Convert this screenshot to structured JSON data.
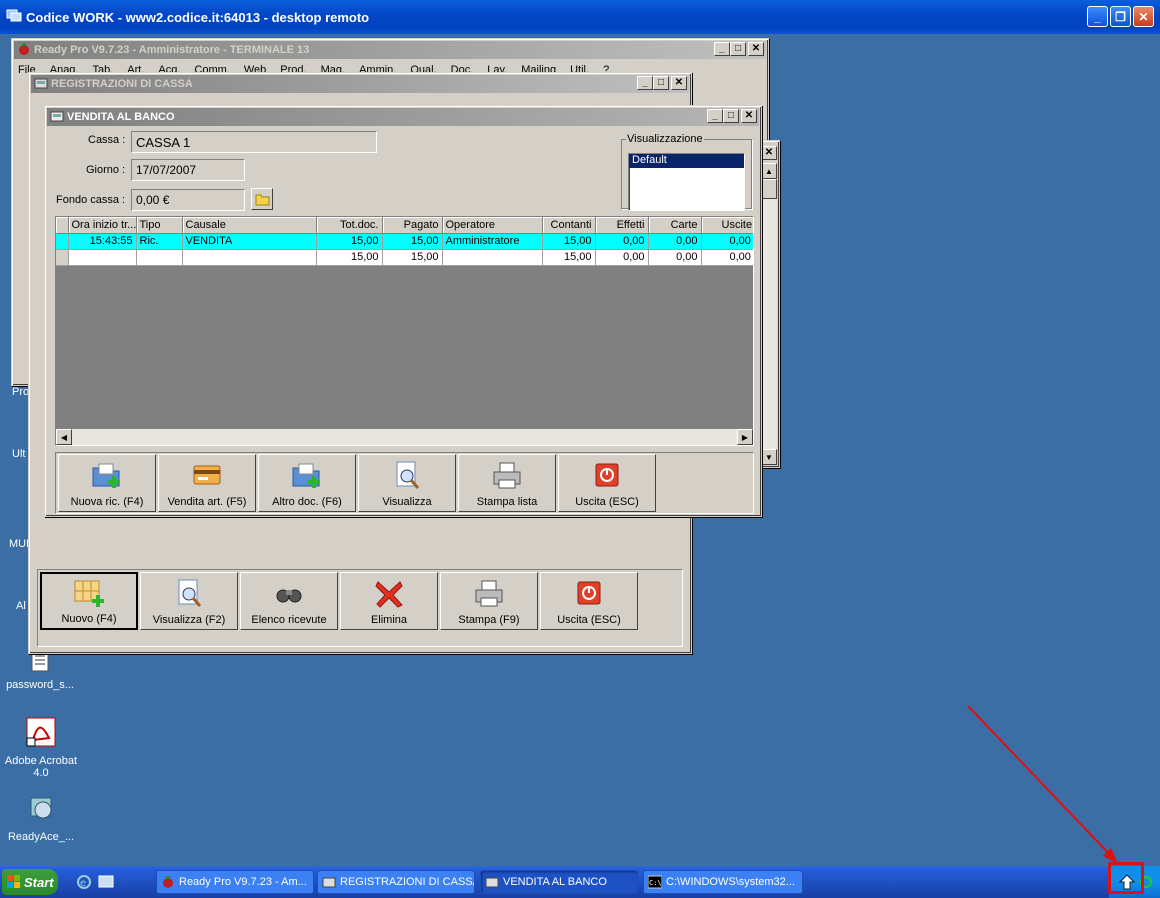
{
  "remote_window": {
    "title": "Codice WORK - www2.codice.it:64013 - desktop remoto"
  },
  "desktop_icons": [
    {
      "label": "password_s..."
    },
    {
      "label": "Adobe Acrobat 4.0"
    },
    {
      "label": "ReadyAce_..."
    }
  ],
  "desktop_partial_labels": [
    "Pro",
    "Ult",
    "MUL",
    "Al"
  ],
  "readypro_window": {
    "title": "Ready Pro V9.7.23 - Amministratore - TERMINALE 13",
    "menu": [
      "File",
      "Anag.",
      "Tab.",
      "Art.",
      "Acq.",
      "Comm.",
      "Web",
      "Prod.",
      "Mag.",
      "Ammin.",
      "Qual.",
      "Doc.",
      "Lav.",
      "Mailing",
      "Util.",
      "?"
    ]
  },
  "registrazioni_window": {
    "title": "REGISTRAZIONI DI CASSA",
    "buttons": [
      {
        "label": "Nuovo (F4)",
        "icon": "new-grid-icon"
      },
      {
        "label": "Visualizza (F2)",
        "icon": "magnifier-doc-icon"
      },
      {
        "label": "Elenco ricevute",
        "icon": "binoculars-icon"
      },
      {
        "label": "Elimina",
        "icon": "red-x-icon"
      },
      {
        "label": "Stampa (F9)",
        "icon": "printer-icon"
      },
      {
        "label": "Uscita (ESC)",
        "icon": "exit-icon"
      }
    ]
  },
  "vendita_window": {
    "title": "VENDITA AL BANCO",
    "cassa_label": "Cassa :",
    "cassa_value": "CASSA 1",
    "giorno_label": "Giorno :",
    "giorno_value": "17/07/2007",
    "fondo_label": "Fondo cassa :",
    "fondo_value": "0,00 €",
    "visualizzazione_label": "Visualizzazione",
    "visualizzazione_selected": "Default",
    "columns": [
      "Ora inizio tr...",
      "Tipo",
      "Causale",
      "Tot.doc.",
      "Pagato",
      "Operatore",
      "Contanti",
      "Effetti",
      "Carte",
      "Uscite"
    ],
    "rows": [
      {
        "ora": "15:43:55",
        "tipo": "Ric.",
        "causale": "VENDITA",
        "tot": "15,00",
        "pagato": "15,00",
        "operatore": "Amministratore",
        "contanti": "15,00",
        "effetti": "0,00",
        "carte": "0,00",
        "uscite": "0,00",
        "selected": true
      },
      {
        "ora": "",
        "tipo": "",
        "causale": "",
        "tot": "15,00",
        "pagato": "15,00",
        "operatore": "",
        "contanti": "15,00",
        "effetti": "0,00",
        "carte": "0,00",
        "uscite": "0,00",
        "selected": false
      }
    ],
    "buttons": [
      {
        "label": "Nuova ric. (F4)",
        "icon": "folder-add-icon"
      },
      {
        "label": "Vendita art. (F5)",
        "icon": "card-icon"
      },
      {
        "label": "Altro doc. (F6)",
        "icon": "folder-add-icon"
      },
      {
        "label": "Visualizza",
        "icon": "magnifier-doc-icon"
      },
      {
        "label": "Stampa lista",
        "icon": "printer-icon"
      },
      {
        "label": "Uscita (ESC)",
        "icon": "exit-icon"
      }
    ]
  },
  "taskbar": {
    "start_label": "Start",
    "items": [
      {
        "label": "Ready Pro V9.7.23 - Am..."
      },
      {
        "label": "REGISTRAZIONI DI CASSA"
      },
      {
        "label": "VENDITA AL BANCO"
      },
      {
        "label": "C:\\WINDOWS\\system32..."
      }
    ]
  },
  "colors": {
    "desktop": "#3a6ea5",
    "selected_row": "#00ffff",
    "annotation": "#e01010"
  }
}
